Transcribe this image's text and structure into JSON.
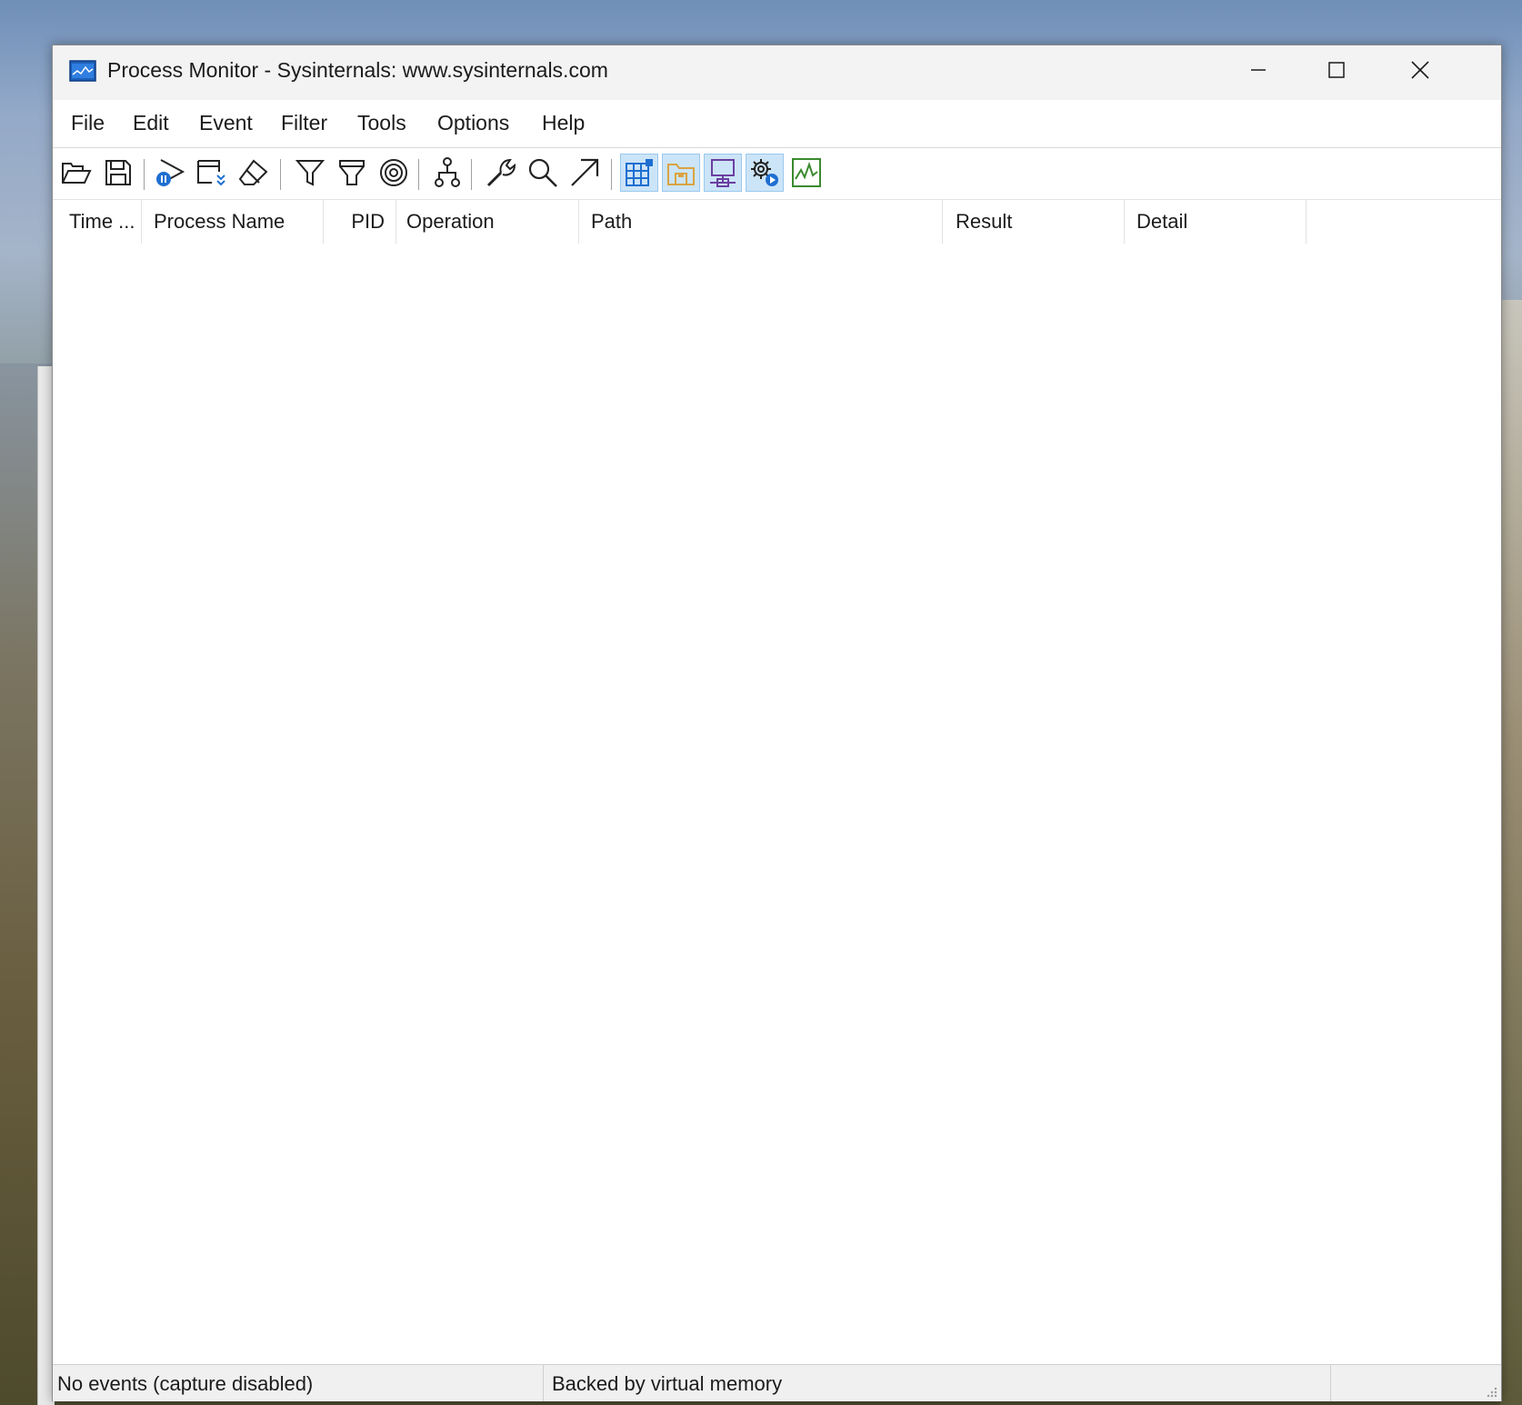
{
  "window": {
    "title": "Process Monitor - Sysinternals: www.sysinternals.com"
  },
  "menu": {
    "items": [
      "File",
      "Edit",
      "Event",
      "Filter",
      "Tools",
      "Options",
      "Help"
    ]
  },
  "toolbar": {
    "buttons": [
      {
        "icon": "open-folder-icon",
        "active": false
      },
      {
        "icon": "save-icon",
        "active": false
      },
      {
        "icon": "capture-icon",
        "active": false
      },
      {
        "icon": "autoscroll-icon",
        "active": false
      },
      {
        "icon": "clear-icon",
        "active": false
      },
      {
        "icon": "filter-icon",
        "active": false
      },
      {
        "icon": "highlight-icon",
        "active": false
      },
      {
        "icon": "target-icon",
        "active": false
      },
      {
        "icon": "process-tree-icon",
        "active": false
      },
      {
        "icon": "properties-icon",
        "active": false
      },
      {
        "icon": "find-icon",
        "active": false
      },
      {
        "icon": "jump-to-icon",
        "active": false
      },
      {
        "icon": "registry-activity-icon",
        "active": true
      },
      {
        "icon": "file-activity-icon",
        "active": true
      },
      {
        "icon": "network-activity-icon",
        "active": true
      },
      {
        "icon": "process-thread-activity-icon",
        "active": true
      },
      {
        "icon": "profiling-events-icon",
        "active": false
      }
    ]
  },
  "columns": [
    "Time ...",
    "Process Name",
    "PID",
    "Operation",
    "Path",
    "Result",
    "Detail"
  ],
  "status": {
    "events": "No events (capture disabled)",
    "backing": "Backed by virtual memory"
  },
  "colors": {
    "accent_blue": "#1e6fd0",
    "file_orange": "#d9a441",
    "network_purple": "#6b3fa0",
    "profiling_green": "#3a8a2e",
    "toggle_bg": "#cce4f7"
  }
}
